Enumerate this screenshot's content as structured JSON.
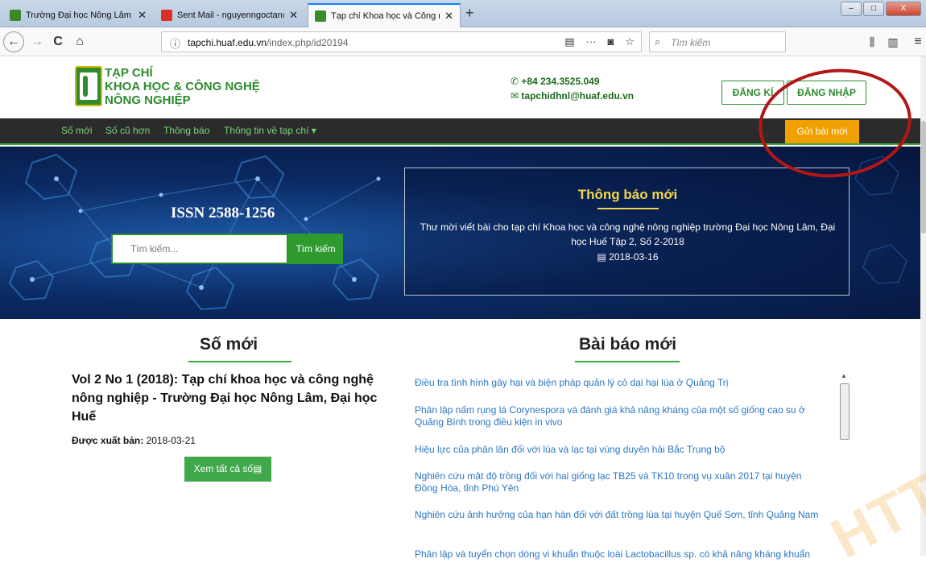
{
  "browser": {
    "tabs": [
      {
        "label": "Trường Đại học Nông Lâm Huế",
        "favicon_color": "#3a8a2a",
        "active": false
      },
      {
        "label": "Sent Mail - nguyenngoctan@hu",
        "favicon_color": "#d93025",
        "active": false
      },
      {
        "label": "Tạp chí Khoa học và Công nghệ",
        "favicon_color": "#3a8a2a",
        "active": true
      }
    ],
    "tab_close": "✕",
    "new_tab": "+",
    "window_buttons": {
      "minimize": "–",
      "maximize": "□",
      "close": "X"
    },
    "nav": {
      "back": "←",
      "forward": "→",
      "reload": "C",
      "home": "⌂"
    },
    "url_domain": "tapchi.huaf.edu.vn",
    "url_path": "/index.php/id20194",
    "url_icons": {
      "reader": "▤",
      "more": "···",
      "pocket": "◙",
      "bookmark": "☆"
    },
    "search_placeholder": "Tìm kiếm",
    "right_icons": {
      "library": "⫼",
      "sidebar": "▥",
      "menu": "≡"
    }
  },
  "header": {
    "logo_lines": [
      "TẠP CHÍ",
      "KHOA HỌC & CÔNG NGHỆ",
      "NÔNG NGHIỆP"
    ],
    "phone": "+84 234.3525.049",
    "email": "tapchidhnl@huaf.edu.vn",
    "register": "ĐĂNG KÍ",
    "login": "ĐĂNG NHẬP"
  },
  "nav": {
    "items": [
      "Số mới",
      "Số cũ hơn",
      "Thông báo",
      "Thông tin về tạp chí ▾"
    ],
    "submit": "Gửi bài mới"
  },
  "hero": {
    "issn": "ISSN 2588-1256",
    "search_placeholder": "Tìm kiếm...",
    "search_button": "Tìm kiếm",
    "notice_title": "Thông báo mới",
    "notice_text": "Thư mời viết bài cho tạp chí Khoa học và công nghệ nông nghiệp trường Đại học Nông Lâm, Đại học Huế Tập 2, Số 2-2018",
    "notice_date": "2018-03-16"
  },
  "latest_issue": {
    "heading": "Số mới",
    "title": "Vol 2 No 1 (2018): Tạp chí khoa học và công nghệ nông nghiệp - Trường Đại học Nông Lâm, Đại học Huế",
    "published_label": "Được xuất bản:",
    "published_date": "2018-03-21",
    "view_all": "Xem tất cả số"
  },
  "articles": {
    "heading": "Bài báo mới",
    "items": [
      "Điều tra tình hình gây hại và biện pháp quản lý cỏ dại hại lúa ở Quảng Trị",
      "Phân lập nấm rụng lá Corynespora và đánh giá khả năng kháng của một số giống cao su ở Quảng Bình trong điều kiện in vivo",
      "Hiệu lực của phân lân đối với lúa và lạc tại vùng duyên hải Bắc Trung bộ",
      "Nghiên cứu mật độ trồng đối với hai giống lạc TB25 và TK10 trong vụ xuân 2017 tại huyện Đồng Hòa, tỉnh Phú Yên",
      "Nghiên cứu ảnh hưởng của hạn hán đối với đất trồng lúa tại huyện Quế Sơn, tỉnh Quảng Nam",
      "Phân lập và tuyển chọn dòng vi khuẩn thuộc loài Lactobacillus sp. có khả năng kháng khuẩn"
    ]
  },
  "colors": {
    "brand_green": "#2e8b2e",
    "accent_orange": "#f0a100",
    "link_blue": "#2a77c4",
    "annotation_red": "#b11717"
  },
  "watermark": "HTT"
}
